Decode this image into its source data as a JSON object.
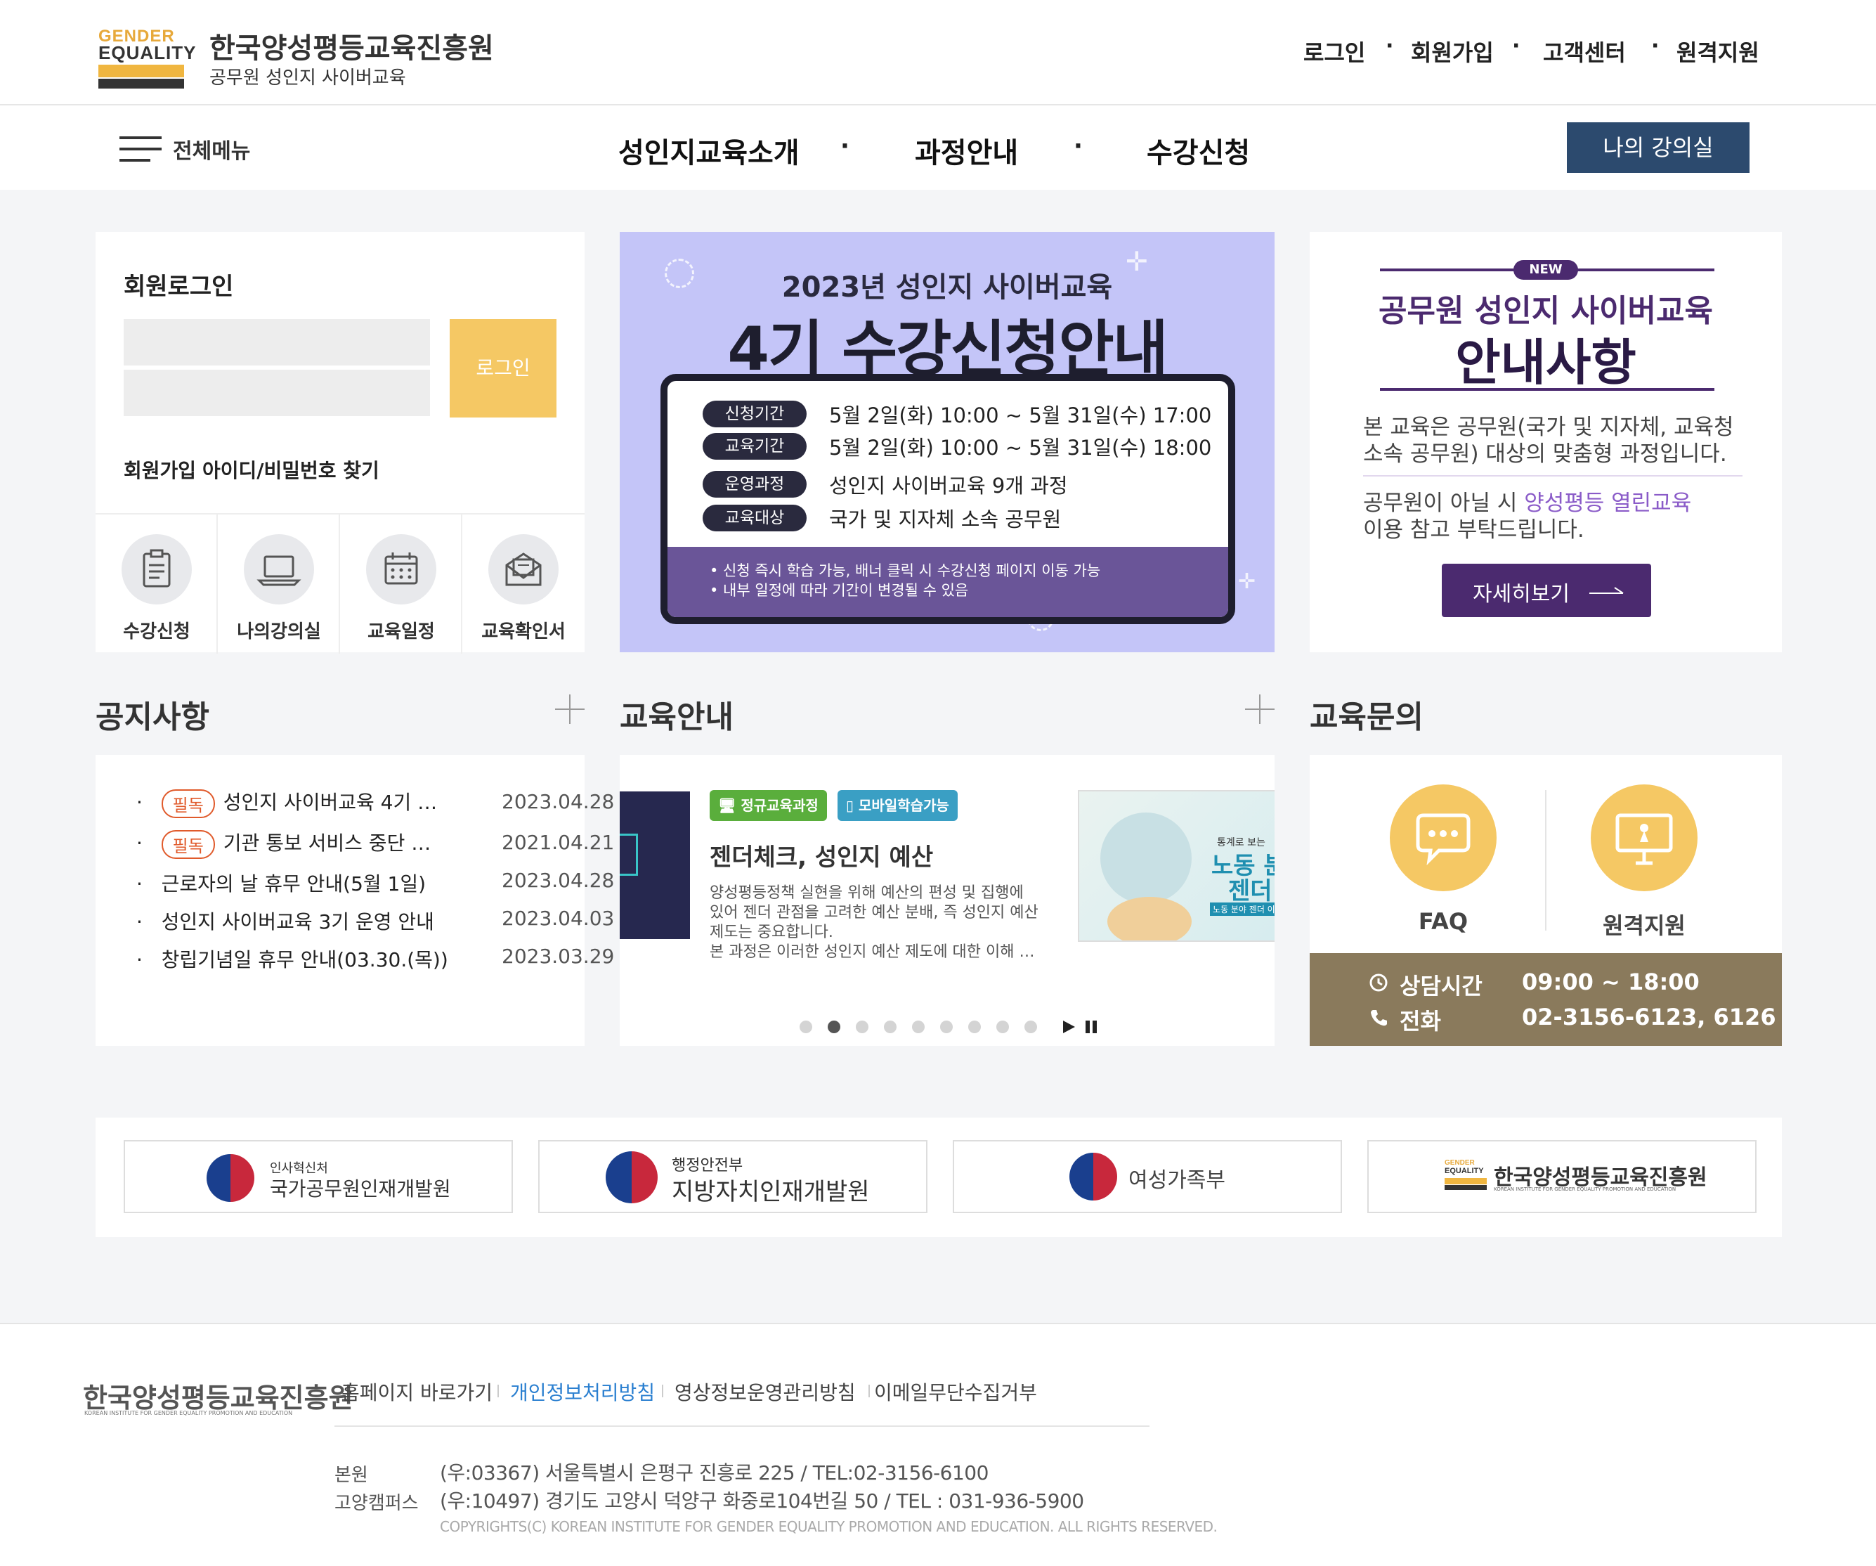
{
  "header": {
    "logo": {
      "word1": "GENDER",
      "word2": "EQUALITY"
    },
    "org_name": "한국양성평등교육진흥원",
    "site_name": "공무원 성인지 사이버교육",
    "util_links": [
      "로그인",
      "회원가입",
      "고객센터",
      "원격지원"
    ]
  },
  "nav": {
    "all_menu": "전체메뉴",
    "items": [
      "성인지교육소개",
      "과정안내",
      "수강신청"
    ],
    "my_class": "나의 강의실"
  },
  "login": {
    "title": "회원로그인",
    "id_placeholder": "",
    "pw_placeholder": "",
    "login_button": "로그인",
    "join": "회원가입",
    "find": "아이디/비밀번호 찾기",
    "quick": [
      {
        "label": "수강신청",
        "icon": "clipboard-icon"
      },
      {
        "label": "나의강의실",
        "icon": "laptop-icon"
      },
      {
        "label": "교육일정",
        "icon": "calendar-icon"
      },
      {
        "label": "교육확인서",
        "icon": "envelope-icon"
      }
    ]
  },
  "banner": {
    "top": "2023년 성인지 사이버교육",
    "main": "4기 수강신청안내",
    "rows": [
      {
        "label": "신청기간",
        "value": "5월 2일(화) 10:00 ~ 5월 31일(수) 17:00"
      },
      {
        "label": "교육기간",
        "value": "5월 2일(화) 10:00 ~ 5월 31일(수) 18:00"
      },
      {
        "label": "운영과정",
        "value": "성인지 사이버교육 9개 과정"
      },
      {
        "label": "교육대상",
        "value": "국가 및 지자체 소속 공무원"
      }
    ],
    "notes": [
      "• 신청 즉시 학습 가능, 배너 클릭 시 수강신청 페이지 이동 가능",
      "• 내부 일정에 따라 기간이 변경될 수 있음"
    ]
  },
  "guide": {
    "badge": "NEW",
    "title1": "공무원 성인지 사이버교육",
    "title2": "안내사항",
    "p1a": "본 교육은 공무원(국가 및 지자체, 교육청",
    "p1b": "소속 공무원) 대상의 맞춤형 과정입니다.",
    "p2a_pre": "공무원이 아닐 시 ",
    "p2a_link": "양성평등 열린교육",
    "p2b": "이용 참고 부탁드립니다.",
    "button": "자세히보기"
  },
  "notice": {
    "title": "공지사항",
    "pinned_label": "필독",
    "items": [
      {
        "pinned": true,
        "text": "성인지 사이버교육 4기 …",
        "date": "2023.04.28"
      },
      {
        "pinned": true,
        "text": "기관 통보 서비스 중단 …",
        "date": "2021.04.21"
      },
      {
        "pinned": false,
        "text": "근로자의 날 휴무 안내(5월 1일)",
        "date": "2023.04.28"
      },
      {
        "pinned": false,
        "text": "성인지 사이버교육 3기 운영 안내",
        "date": "2023.04.03"
      },
      {
        "pinned": false,
        "text": "창립기념일 휴무 안내(03.30.(목))",
        "date": "2023.03.29"
      }
    ]
  },
  "edu": {
    "title": "교육안내",
    "tag1": "정규교육과정",
    "tag2": "모바일학습가능",
    "course_title": "젠더체크, 성인지 예산",
    "desc": [
      "양성평등정책 실현을 위해 예산의 편성 및 집행에",
      "있어 젠더 관점을 고려한 예산 분배, 즉 성인지 예산",
      "제도는 중요합니다.",
      "본 과정은 이러한 성인지 예산 제도에 대한 이해 …"
    ],
    "thumb_small": "통계로 보는",
    "thumb_big1": "노동 분",
    "thumb_big2": "젠더",
    "thumb_tiny": "노동 분야 젠더 이슈",
    "pages": 9,
    "active_page": 2
  },
  "inquiry": {
    "title": "교육문의",
    "faq": "FAQ",
    "remote": "원격지원",
    "hours_label": "상담시간",
    "hours": "09:00 ~ 18:00",
    "phone_label": "전화",
    "phone": "02-3156-6123, 6126"
  },
  "partners": [
    {
      "small": "인사혁신처",
      "big": "국가공무원인재개발원"
    },
    {
      "small": "행정안전부",
      "big": "지방자치인재개발원"
    },
    {
      "small": "",
      "big": "여성가족부"
    },
    {
      "small": "",
      "big": "한국양성평등교육진흥원"
    }
  ],
  "partner4_logo": {
    "w1": "GENDER",
    "w2": "EQUALITY",
    "sub": "KOREAN INSTITUTE FOR GENDER EQUALITY PROMOTION AND EDUCATION"
  },
  "footer": {
    "logo": "한국양성평등교육진흥원",
    "logo_sub": "KOREAN INSTITUTE FOR GENDER EQUALITY PROMOTION AND EDUCATION",
    "links": [
      "홈페이지 바로가기",
      "개인정보처리방침",
      "영상정보운영관리방침",
      "이메일무단수집거부"
    ],
    "addr1_label": "본원",
    "addr1": "(우:03367) 서울특별시 은평구 진흥로 225 / TEL:02-3156-6100",
    "addr2_label": "고양캠퍼스",
    "addr2": "(우:10497) 경기도 고양시 덕양구 화중로104번길 50 / TEL : 031-936-5900",
    "copyright": "COPYRIGHTS(C) KOREAN INSTITUTE FOR GENDER EQUALITY PROMOTION AND EDUCATION. ALL RIGHTS RESERVED."
  },
  "colors": {
    "accent_navy": "#2c4a6e",
    "login_yellow": "#f5c864",
    "purple": "#4b2a6f",
    "brown": "#8a7a5c",
    "faq_yellow": "#f5c864"
  }
}
